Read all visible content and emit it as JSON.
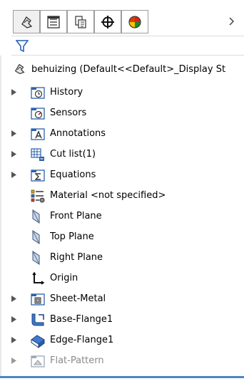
{
  "tabs": [
    {
      "name": "featuremanager-tab",
      "icon": "feature-tree-icon",
      "active": true
    },
    {
      "name": "propertymanager-tab",
      "icon": "property-list-icon",
      "active": false
    },
    {
      "name": "configurationmanager-tab",
      "icon": "configuration-icon",
      "active": false
    },
    {
      "name": "dimxpertmanager-tab",
      "icon": "crosshair-icon",
      "active": false
    },
    {
      "name": "displaymanager-tab",
      "icon": "color-pie-icon",
      "active": false
    }
  ],
  "more_icon": "chevron-right-icon",
  "filter_icon": "funnel-icon",
  "root": {
    "label": "behuizing  (Default<<Default>_Display St",
    "icon": "part-icon"
  },
  "tree": [
    {
      "label": "History",
      "icon": "history-folder-icon",
      "expandable": true
    },
    {
      "label": "Sensors",
      "icon": "sensors-folder-icon",
      "expandable": false
    },
    {
      "label": "Annotations",
      "icon": "annotations-folder-icon",
      "expandable": true
    },
    {
      "label": "Cut list(1)",
      "icon": "cut-list-icon",
      "expandable": true
    },
    {
      "label": "Equations",
      "icon": "equations-folder-icon",
      "expandable": true
    },
    {
      "label": "Material <not specified>",
      "icon": "material-icon",
      "expandable": false
    },
    {
      "label": "Front Plane",
      "icon": "plane-icon",
      "expandable": false
    },
    {
      "label": "Top Plane",
      "icon": "plane-icon",
      "expandable": false
    },
    {
      "label": "Right Plane",
      "icon": "plane-icon",
      "expandable": false
    },
    {
      "label": "Origin",
      "icon": "origin-icon",
      "expandable": false
    },
    {
      "label": "Sheet-Metal",
      "icon": "sheet-metal-icon",
      "expandable": true
    },
    {
      "label": "Base-Flange1",
      "icon": "base-flange-icon",
      "expandable": true
    },
    {
      "label": "Edge-Flange1",
      "icon": "edge-flange-icon",
      "expandable": true
    },
    {
      "label": "Flat-Pattern",
      "icon": "flat-pattern-icon",
      "expandable": true,
      "suppressed": true
    }
  ],
  "colors": {
    "accent": "#4a87c8",
    "folder_blue": "#2b62ad",
    "suppressed_text": "#8a8a8a"
  }
}
